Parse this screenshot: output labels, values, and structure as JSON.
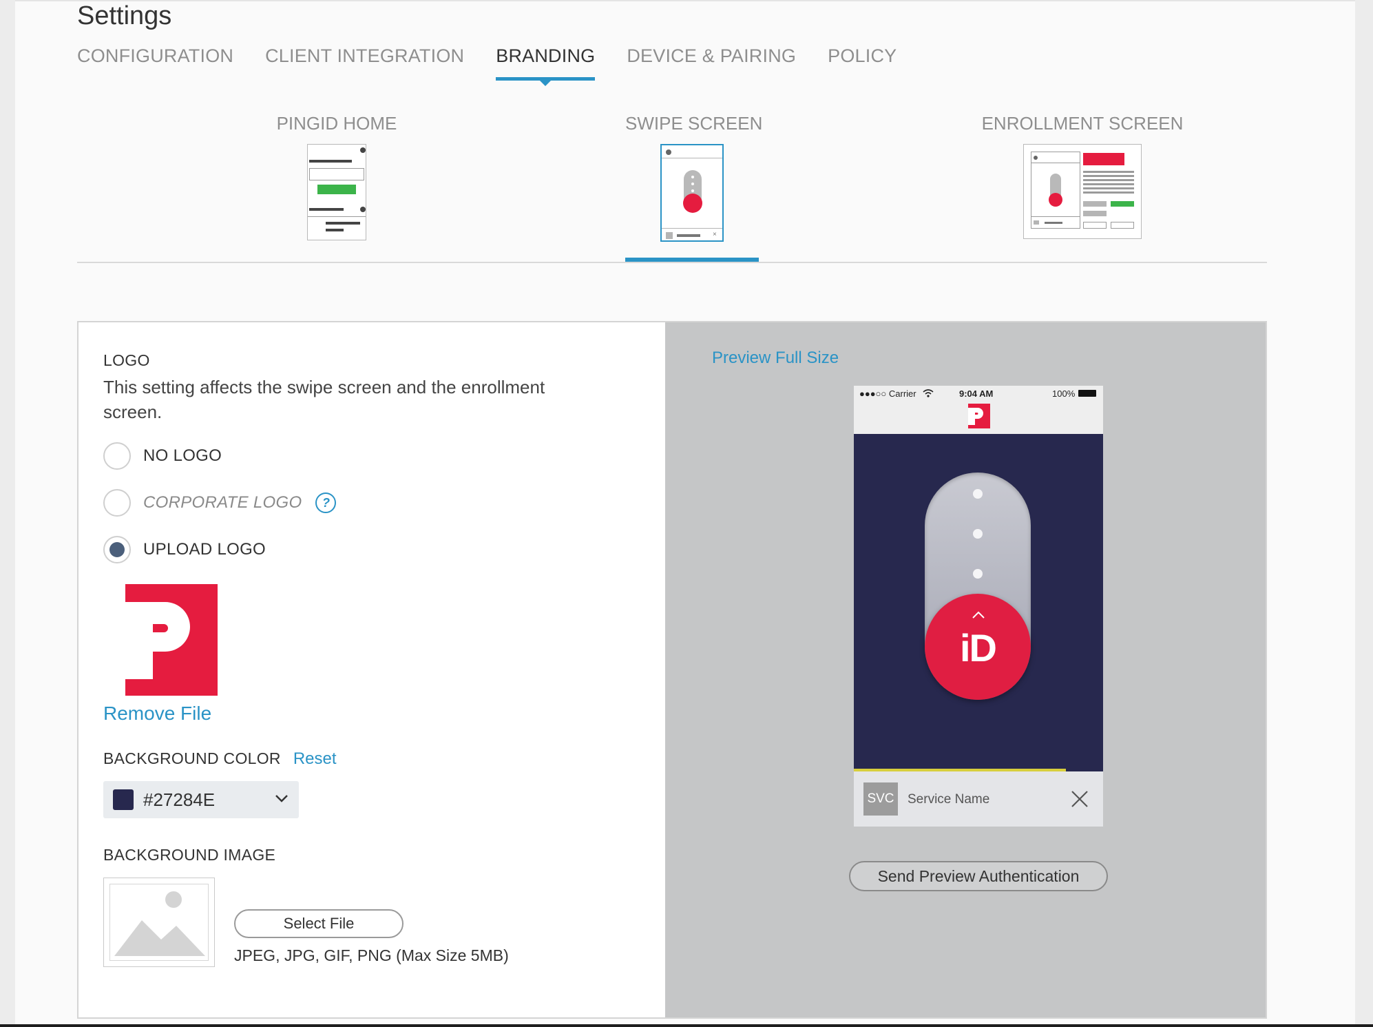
{
  "page": {
    "title": "Settings"
  },
  "tabs": [
    {
      "label": "CONFIGURATION"
    },
    {
      "label": "CLIENT INTEGRATION"
    },
    {
      "label": "BRANDING"
    },
    {
      "label": "DEVICE & PAIRING"
    },
    {
      "label": "POLICY"
    }
  ],
  "active_tab": "BRANDING",
  "subtabs": [
    {
      "label": "PINGID HOME"
    },
    {
      "label": "SWIPE SCREEN"
    },
    {
      "label": "ENROLLMENT SCREEN"
    }
  ],
  "active_subtab": "SWIPE SCREEN",
  "logo": {
    "label": "LOGO",
    "description": "This setting affects the swipe screen and the enrollment screen.",
    "options": [
      {
        "label": "NO LOGO",
        "selected": false
      },
      {
        "label": "CORPORATE LOGO",
        "selected": false
      },
      {
        "label": "UPLOAD LOGO",
        "selected": true
      }
    ],
    "help_glyph": "?",
    "remove_file": "Remove File"
  },
  "background_color": {
    "label": "BACKGROUND COLOR",
    "reset": "Reset",
    "value": "#27284E"
  },
  "background_image": {
    "label": "BACKGROUND IMAGE",
    "select_file": "Select File",
    "hint": "JPEG, JPG, GIF, PNG (Max Size 5MB)"
  },
  "preview": {
    "full_size_link": "Preview Full Size",
    "status": {
      "carrier": "●●●○○ Carrier",
      "time": "9:04 AM",
      "battery": "100%"
    },
    "knob_text": "iD",
    "svc_badge": "SVC",
    "service_name": "Service Name",
    "send_button": "Send Preview Authentication"
  },
  "colors": {
    "accent": "#2a93c6",
    "brand_red": "#e51c3f",
    "phone_background": "#27284E"
  }
}
